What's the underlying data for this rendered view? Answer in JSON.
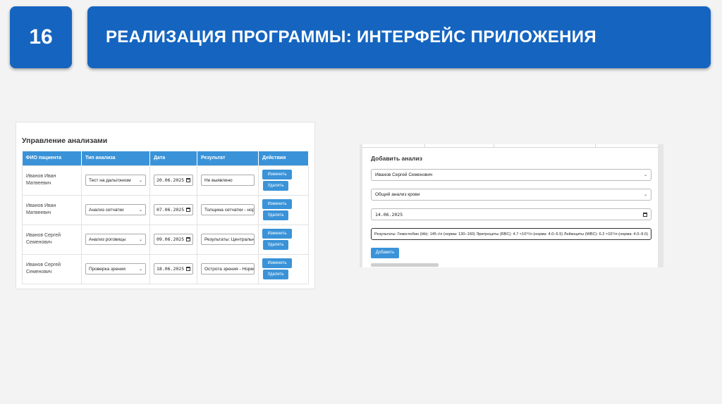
{
  "slide": {
    "number": "16",
    "title": "РЕАЛИЗАЦИЯ ПРОГРАММЫ: ИНТЕРФЕЙС ПРИЛОЖЕНИЯ"
  },
  "analyses_panel": {
    "title": "Управление анализами",
    "columns": [
      "ФИО пациента",
      "Тип анализа",
      "Дата",
      "Результат",
      "Действия"
    ],
    "edit_label": "Изменить",
    "delete_label": "Удалить",
    "rows": [
      {
        "patient": "Иванов Иван Матвеевич",
        "type": "Тест на дальтонизм",
        "date": "20.06.2025",
        "result": "Не выявлено"
      },
      {
        "patient": "Иванов Иван Матвеевич",
        "type": "Анализ сетчатки",
        "date": "07.06.2025",
        "result": "Толщина сетчатки - норм"
      },
      {
        "patient": "Иванов Сергей Семенович",
        "type": "Анализ роговицы",
        "date": "09.06.2025",
        "result": "Результаты: Центральн"
      },
      {
        "patient": "Иванов Сергей Семенович",
        "type": "Проверка зрения",
        "date": "18.06.2025",
        "result": "Острота зрения - Норма"
      }
    ]
  },
  "add_panel": {
    "title": "Добавить анализ",
    "patient_value": "Иванов Сергей Семенович",
    "type_value": "Общий анализ крови",
    "date_value": "14.06.2025",
    "result_value": "Результаты: Гемоглобин (Hb): 145 г/л (норма: 130–160) Эритроциты (RBC): 4.7 ×10¹²/л (норма: 4.0–5.5) Лейкоциты (WBC): 6.2 ×10⁹/л (норма: 4.0–9.0)",
    "add_label": "Добавить"
  },
  "colors": {
    "brand_blue": "#1565c0",
    "table_header": "#3a93d8",
    "button": "#3a93d8"
  }
}
